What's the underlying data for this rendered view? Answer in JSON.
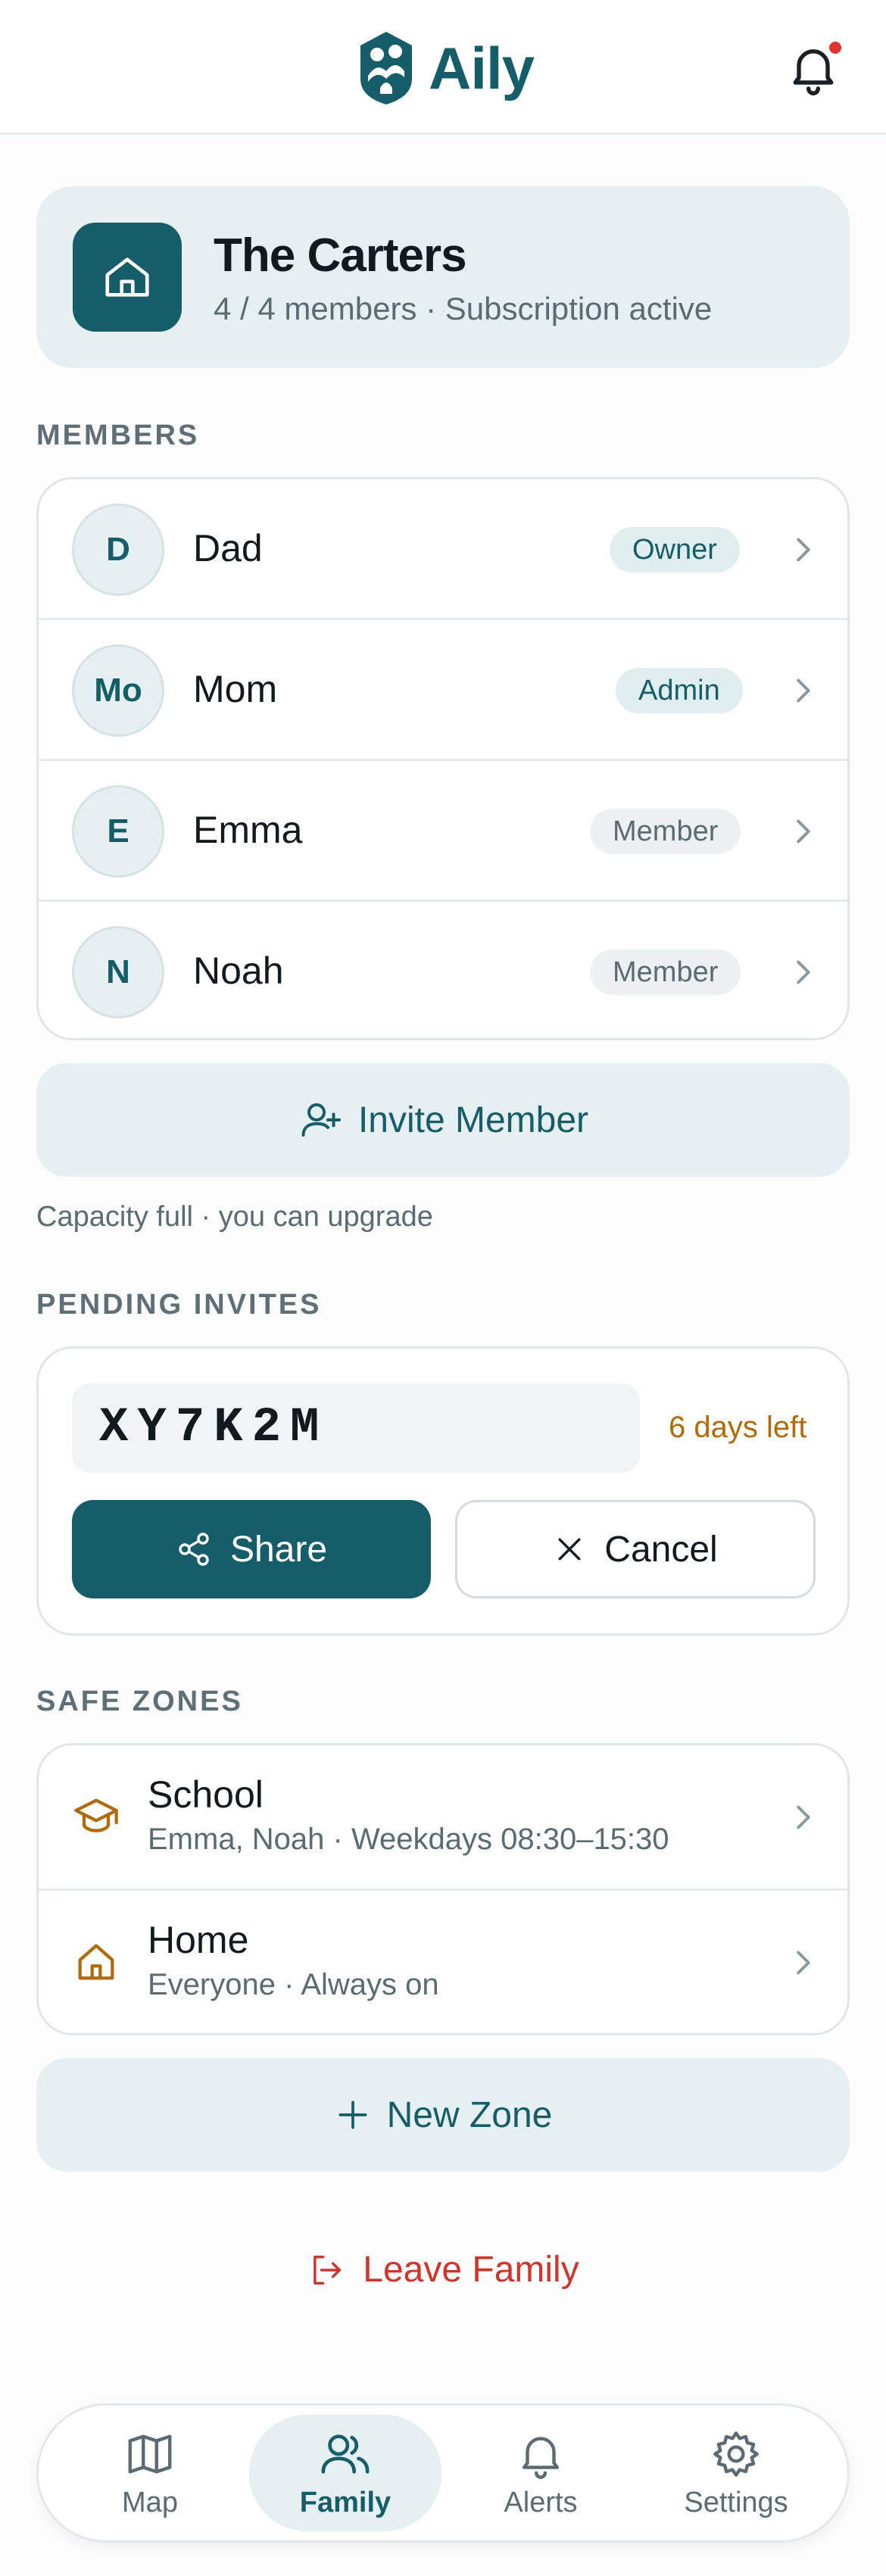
{
  "app": {
    "name": "Aily",
    "accent": "#155E69",
    "alert_dot": "#E1332D"
  },
  "header": {
    "notification_icon": "bell-icon",
    "has_unread": true
  },
  "family": {
    "name": "The Carters",
    "summary": "4 / 4 members · Subscription active",
    "icon": "home-icon"
  },
  "members": {
    "section_label": "MEMBERS",
    "items": [
      {
        "initials": "D",
        "name": "Dad",
        "role": "Owner"
      },
      {
        "initials": "Mo",
        "name": "Mom",
        "role": "Admin"
      },
      {
        "initials": "E",
        "name": "Emma",
        "role": "Member"
      },
      {
        "initials": "N",
        "name": "Noah",
        "role": "Member"
      }
    ],
    "invite_label": "Invite Member",
    "capacity_note": "Capacity full · you can upgrade"
  },
  "pending_invites": {
    "section_label": "PENDING INVITES",
    "items": [
      {
        "code": "XY7K2M",
        "expiry": "6 days left",
        "share_label": "Share",
        "cancel_label": "Cancel"
      }
    ]
  },
  "safe_zones": {
    "section_label": "SAFE ZONES",
    "items": [
      {
        "name": "School",
        "detail": "Emma, Noah · Weekdays 08:30–15:30",
        "icon": "graduation-cap-icon"
      },
      {
        "name": "Home",
        "detail": "Everyone · Always on",
        "icon": "home-icon"
      }
    ],
    "new_zone_label": "New Zone"
  },
  "leave_label": "Leave Family",
  "tabbar": {
    "items": [
      {
        "label": "Map",
        "icon": "map-icon",
        "active": false
      },
      {
        "label": "Family",
        "icon": "users-icon",
        "active": true
      },
      {
        "label": "Alerts",
        "icon": "bell-icon",
        "active": false
      },
      {
        "label": "Settings",
        "icon": "gear-icon",
        "active": false
      }
    ]
  }
}
